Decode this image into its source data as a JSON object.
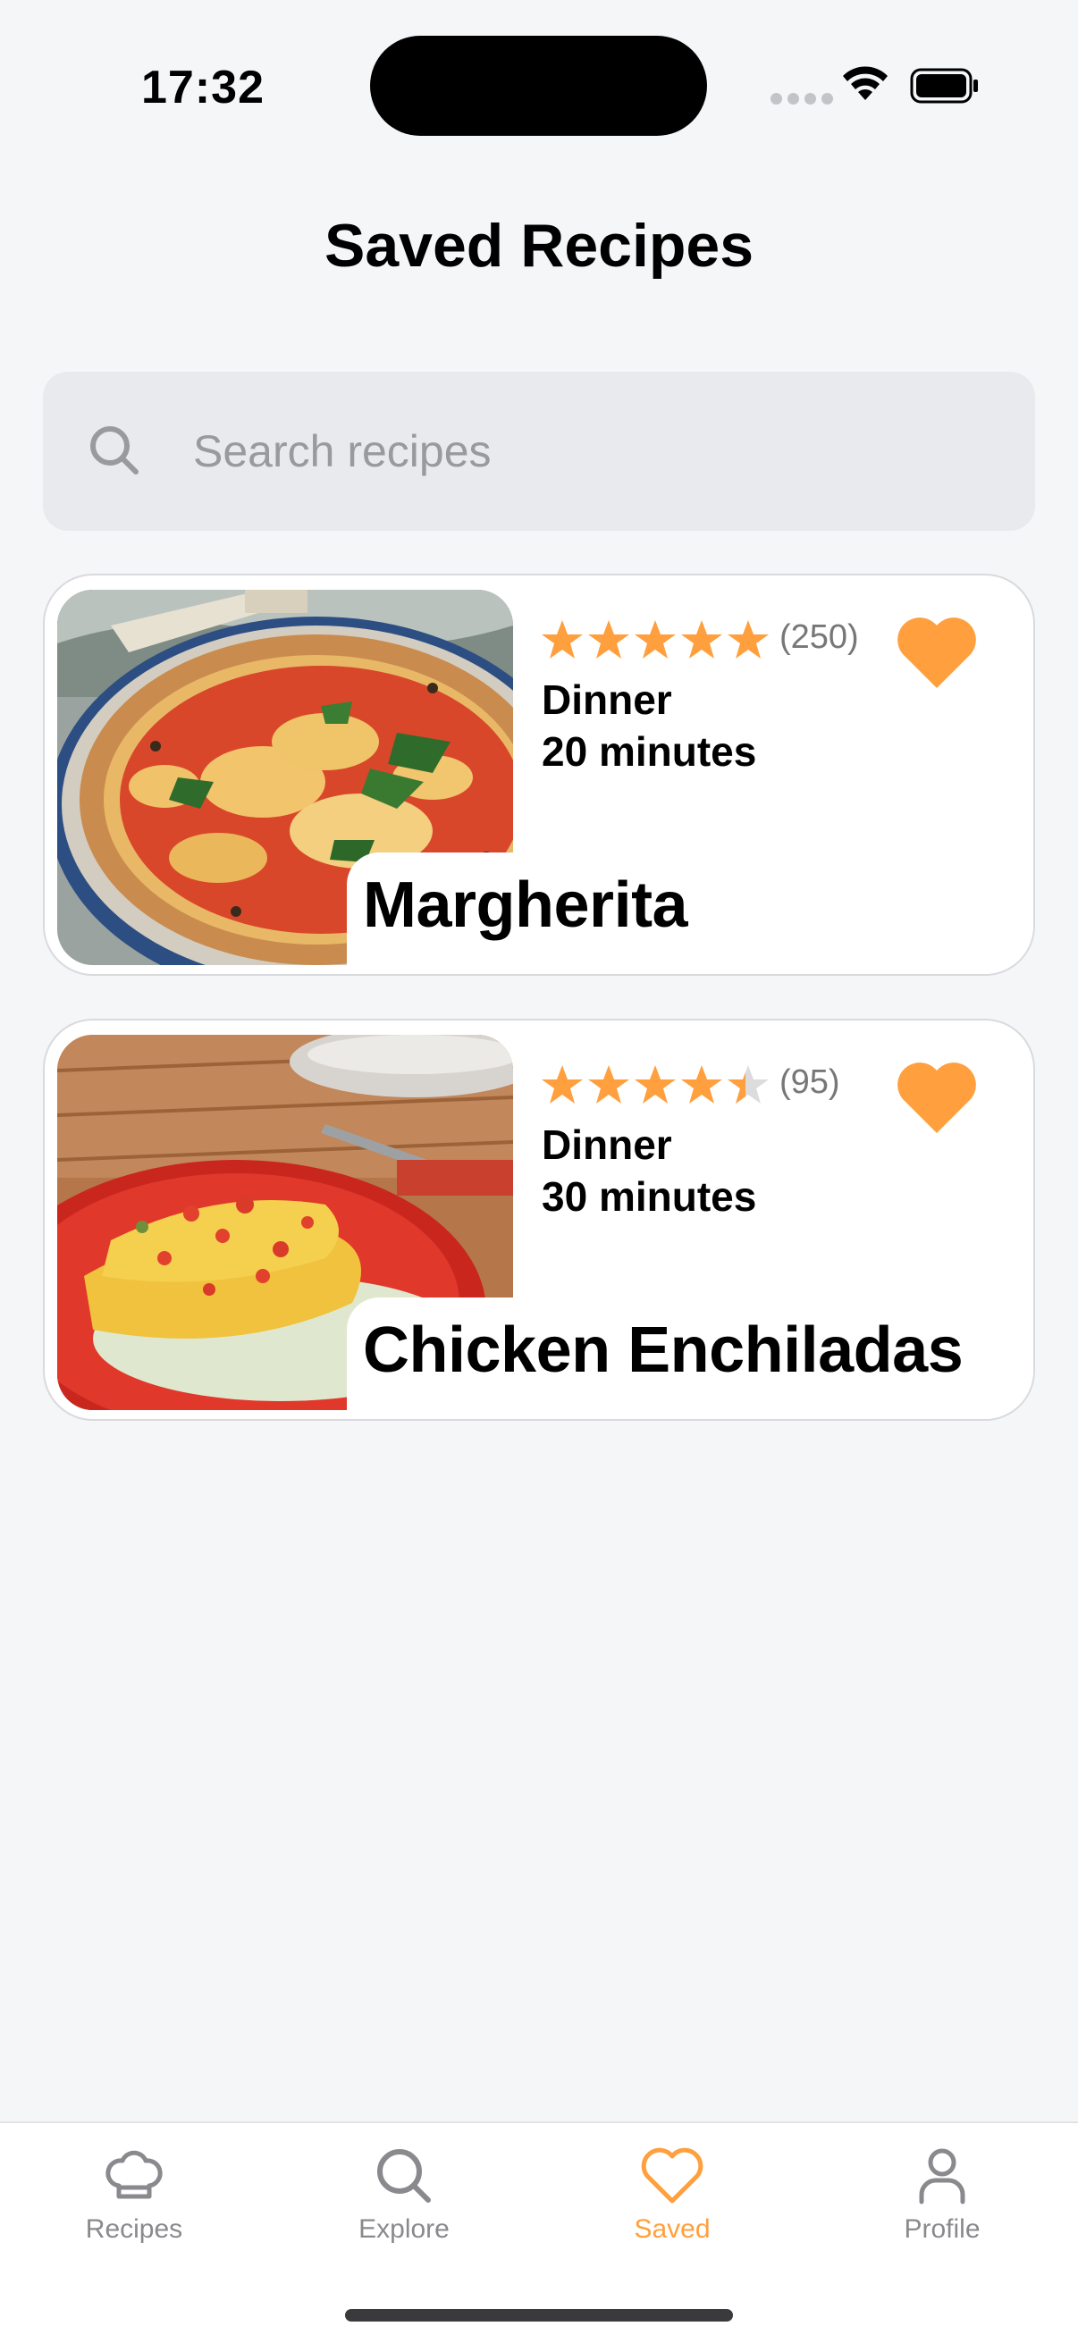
{
  "status_bar": {
    "time": "17:32"
  },
  "header": {
    "title": "Saved Recipes"
  },
  "search": {
    "placeholder": "Search recipes",
    "value": ""
  },
  "recipes": [
    {
      "title": "Margherita",
      "rating": 5,
      "rating_fraction_shown": 1.0,
      "review_count": "(250)",
      "meal_type": "Dinner",
      "cook_time": "20 minutes",
      "favorited": true,
      "image": "margherita-pizza-photo"
    },
    {
      "title": "Chicken Enchiladas",
      "rating": 4.5,
      "rating_fraction_shown": 0.9,
      "review_count": "(95)",
      "meal_type": "Dinner",
      "cook_time": "30 minutes",
      "favorited": true,
      "image": "chicken-enchiladas-photo"
    }
  ],
  "tab_bar": {
    "tabs": [
      {
        "label": "Recipes",
        "icon": "chef-hat-icon",
        "active": false
      },
      {
        "label": "Explore",
        "icon": "search-icon",
        "active": false
      },
      {
        "label": "Saved",
        "icon": "heart-icon",
        "active": true
      },
      {
        "label": "Profile",
        "icon": "person-icon",
        "active": false
      }
    ]
  },
  "colors": {
    "accent": "#ff9f3d",
    "background": "#f5f6f8",
    "inactive": "#8a8a8e",
    "star_empty": "#dcdcde"
  }
}
